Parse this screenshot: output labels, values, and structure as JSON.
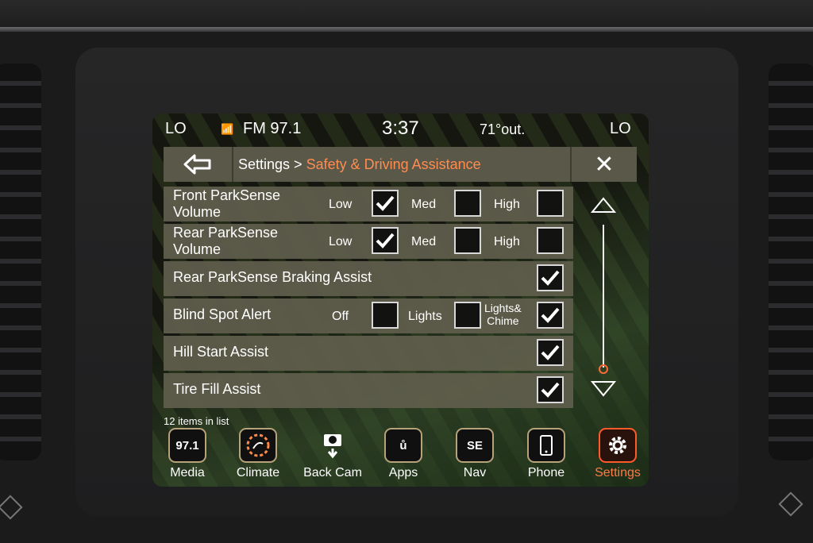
{
  "status": {
    "left_temp": "LO",
    "radio": "FM 97.1",
    "clock": "3:37",
    "outside_temp": "71°out.",
    "right_temp": "LO"
  },
  "header": {
    "crumb_root": "Settings > ",
    "crumb_active": "Safety & Driving Assistance"
  },
  "settings": {
    "front_parksense": {
      "label_line1": "Front ParkSense",
      "label_line2": "Volume",
      "opt_low": "Low",
      "opt_med": "Med",
      "opt_high": "High",
      "selected": "Low"
    },
    "rear_parksense": {
      "label_line1": "Rear ParkSense",
      "label_line2": "Volume",
      "opt_low": "Low",
      "opt_med": "Med",
      "opt_high": "High",
      "selected": "Low"
    },
    "rear_braking": {
      "label": "Rear ParkSense Braking Assist",
      "checked": true
    },
    "blind_spot": {
      "label": "Blind Spot Alert",
      "opt_off": "Off",
      "opt_lights": "Lights",
      "opt_lights_chime_1": "Lights&",
      "opt_lights_chime_2": "Chime",
      "selected": "Lights&Chime"
    },
    "hill_start": {
      "label": "Hill Start Assist",
      "checked": true
    },
    "tire_fill": {
      "label": "Tire Fill Assist",
      "checked": true
    }
  },
  "list_count": "12 items in list",
  "nav": {
    "media_icon": "97.1",
    "media": "Media",
    "climate": "Climate",
    "backcam": "Back Cam",
    "apps_icon": "ů",
    "apps": "Apps",
    "nav_icon": "SE",
    "nav": "Nav",
    "phone": "Phone",
    "settings": "Settings",
    "active": "Settings"
  },
  "colors": {
    "accent": "#ff7a45",
    "row_bg": "#605e4c",
    "titlebar_bg": "#5a5848"
  }
}
